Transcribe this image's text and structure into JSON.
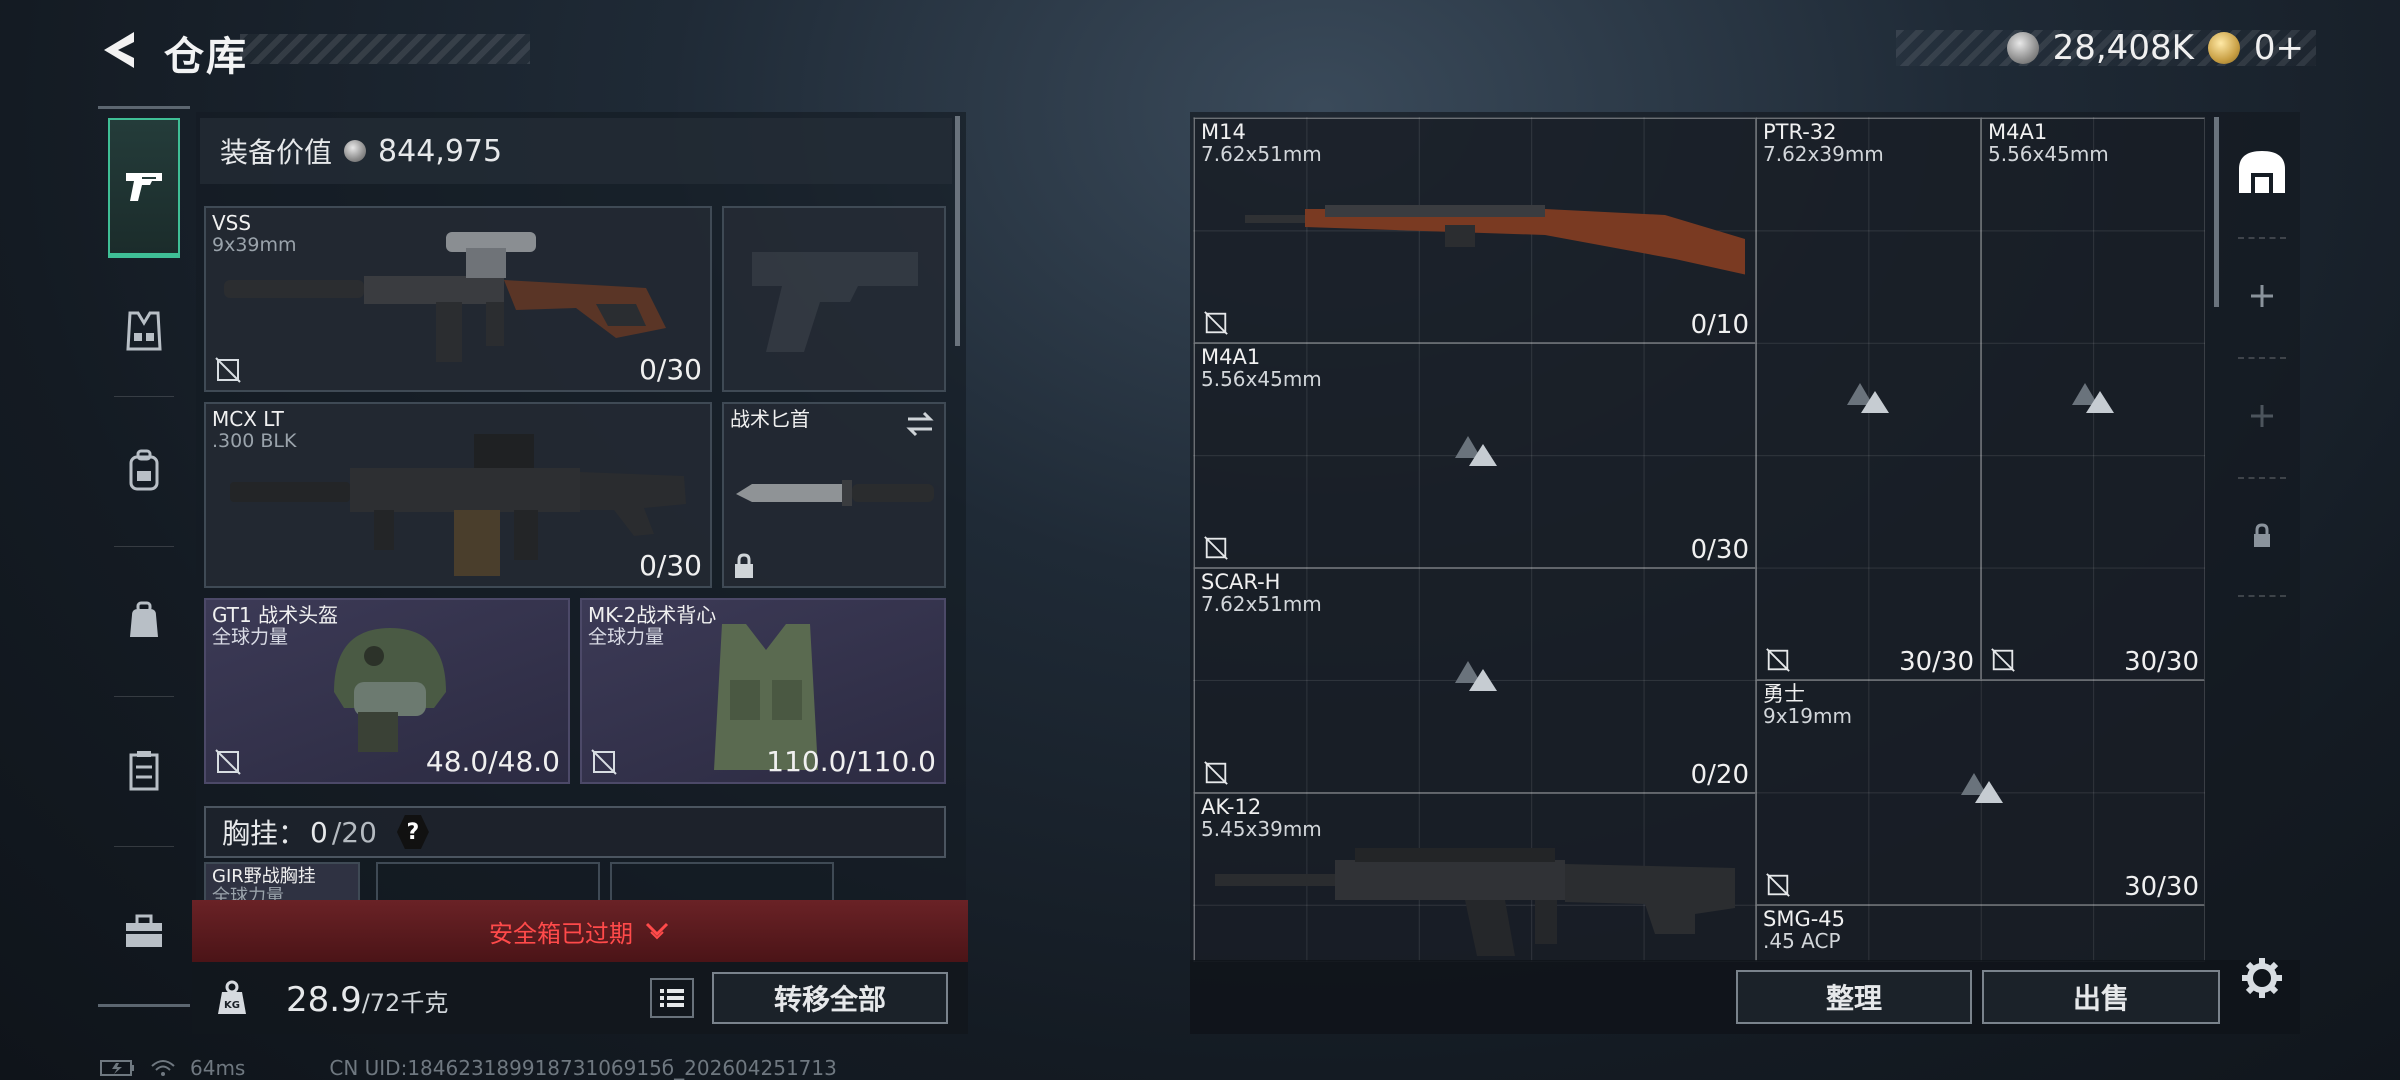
{
  "header": {
    "title": "仓库",
    "currency_silver": "28,408K",
    "currency_gold": "0+"
  },
  "rail": {
    "items": [
      "pistol-icon",
      "vest-icon",
      "backpack-icon",
      "bag-icon",
      "container-icon",
      "toolbox-icon"
    ]
  },
  "equipment": {
    "value_label": "装备价值",
    "value": "844,975",
    "slots": [
      {
        "name": "VSS",
        "sub": "9x39mm",
        "count": "0/30"
      },
      {
        "name": "",
        "sub": "",
        "count": ""
      },
      {
        "name": "MCX LT",
        "sub": ".300 BLK",
        "count": "0/30"
      },
      {
        "name": "战术匕首",
        "sub": "",
        "count": ""
      },
      {
        "name": "GT1 战术头盔",
        "sub": "全球力量",
        "count": "48.0/48.0"
      },
      {
        "name": "MK-2战术背心",
        "sub": "全球力量",
        "count": "110.0/110.0"
      }
    ],
    "chest_label": "胸挂：",
    "chest_value": "0",
    "chest_max": "/20",
    "chest_help": "?",
    "chest_item_name": "GIR野战胸挂",
    "chest_item_sub": "全球力量"
  },
  "safebox": {
    "label": "安全箱已过期"
  },
  "inventory": {
    "weight": "28.9",
    "weight_max": "/72千克",
    "weight_icon": "KG",
    "transfer_label": "转移全部"
  },
  "status": {
    "ping": "64ms",
    "uid": "CN UID:18462318991873106915б_202604251713"
  },
  "stash": {
    "items": [
      {
        "name": "M14",
        "sub": "7.62x51mm",
        "count": "0/10"
      },
      {
        "name": "PTR-32",
        "sub": "7.62x39mm",
        "count": "30/30"
      },
      {
        "name": "M4A1",
        "sub": "5.56x45mm",
        "count": "30/30"
      },
      {
        "name": "M4A1",
        "sub": "5.56x45mm",
        "count": "0/30"
      },
      {
        "name": "SCAR-H",
        "sub": "7.62x51mm",
        "count": "0/20"
      },
      {
        "name": "勇士",
        "sub": "9x19mm",
        "count": "30/30"
      },
      {
        "name": "AK-12",
        "sub": "5.45x39mm",
        "count": ""
      },
      {
        "name": "SMG-45",
        "sub": ".45 ACP",
        "count": ""
      }
    ],
    "sort_label": "整理",
    "sell_label": "出售"
  },
  "colors": {
    "accent": "#3fbf96",
    "danger": "#ff4a4a",
    "purple_slot": "#3c3a56"
  }
}
